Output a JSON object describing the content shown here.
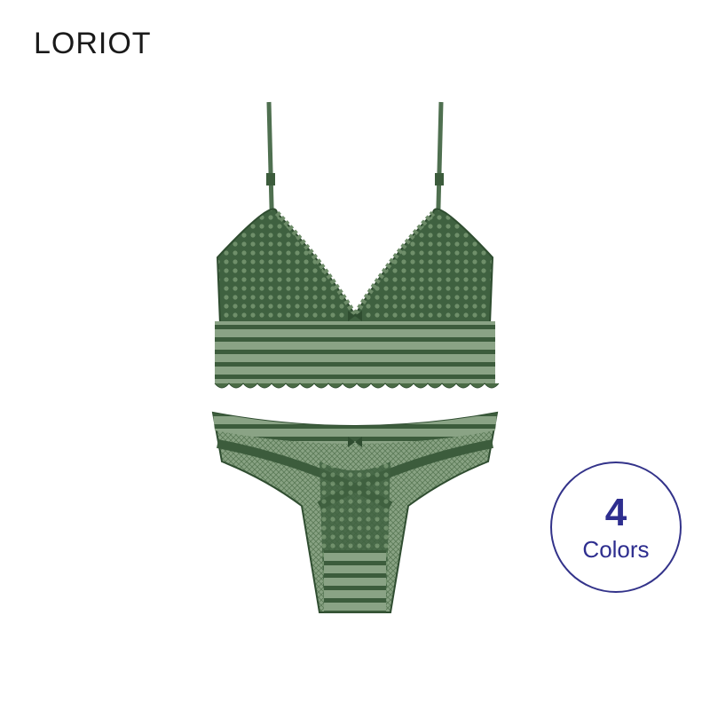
{
  "brand": {
    "name": "LORIOT"
  },
  "badge": {
    "count": "4",
    "label": "Colors",
    "color": "#33338a"
  },
  "product": {
    "image": "green-lace-bralette-and-brief-set",
    "color": "#4a6b45"
  }
}
